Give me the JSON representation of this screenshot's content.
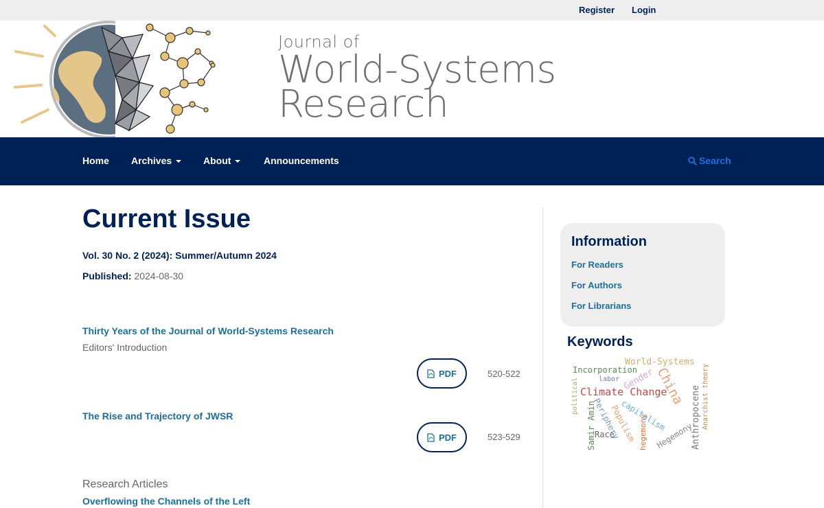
{
  "topbar": {
    "register": "Register",
    "login": "Login"
  },
  "header": {
    "title_small": "Journal of",
    "title_line1": "World-Systems",
    "title_line2": "Research"
  },
  "nav": {
    "home": "Home",
    "archives": "Archives",
    "about": "About",
    "announcements": "Announcements",
    "search": "Search"
  },
  "main": {
    "page_title": "Current Issue",
    "issue_id": "Vol. 30 No. 2 (2024): Summer/Autumn 2024",
    "published_label": "Published:",
    "published_value": "2024-08-30",
    "articles": [
      {
        "title": "Thirty Years of the Journal of World-Systems Research",
        "subtitle": "Editors' Introduction",
        "pdf_label": "PDF",
        "pages": "520-522"
      },
      {
        "title": "The Rise and Trajectory of JWSR",
        "pdf_label": "PDF",
        "pages": "523-529"
      }
    ],
    "section_heading": "Research Articles",
    "next_article_title": "Overflowing the Channels of the Left"
  },
  "sidebar": {
    "info_title": "Information",
    "links": [
      "For Readers",
      "For Authors",
      "For Librarians"
    ],
    "keywords_title": "Keywords",
    "keywords": [
      "World-Systems",
      "Incorporation",
      "labor",
      "Gender",
      "China",
      "Climate Change",
      "political",
      "Samir Amin",
      "Periphery",
      "capitalism",
      "Populism",
      "Anthropocene",
      "Anarchist theory",
      "Race",
      "hegemony",
      "Hegemony"
    ]
  },
  "colors": {
    "navy": "#002155",
    "link": "#1e6f98",
    "search": "#1e6fd9",
    "gray_bg": "#eeeeee"
  }
}
